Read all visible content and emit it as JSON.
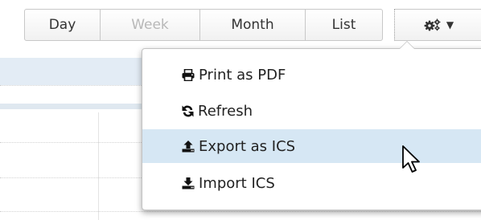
{
  "toolbar": {
    "day_label": "Day",
    "week_label": "Week",
    "month_label": "Month",
    "list_label": "List",
    "options_icon": "gears-icon",
    "options_caret_icon": "caret-down-icon"
  },
  "options_menu": {
    "items": [
      {
        "icon": "print-icon",
        "label": "Print as PDF"
      },
      {
        "icon": "refresh-icon",
        "label": "Refresh"
      },
      {
        "icon": "export-icon",
        "label": "Export as ICS"
      },
      {
        "icon": "import-icon",
        "label": "Import ICS"
      }
    ],
    "highlighted_item": "Export as ICS"
  },
  "colors": {
    "menu_highlight": "#d6e7f4",
    "calendar_header": "#e3ecf5",
    "disabled_text": "#b8b8b8"
  }
}
